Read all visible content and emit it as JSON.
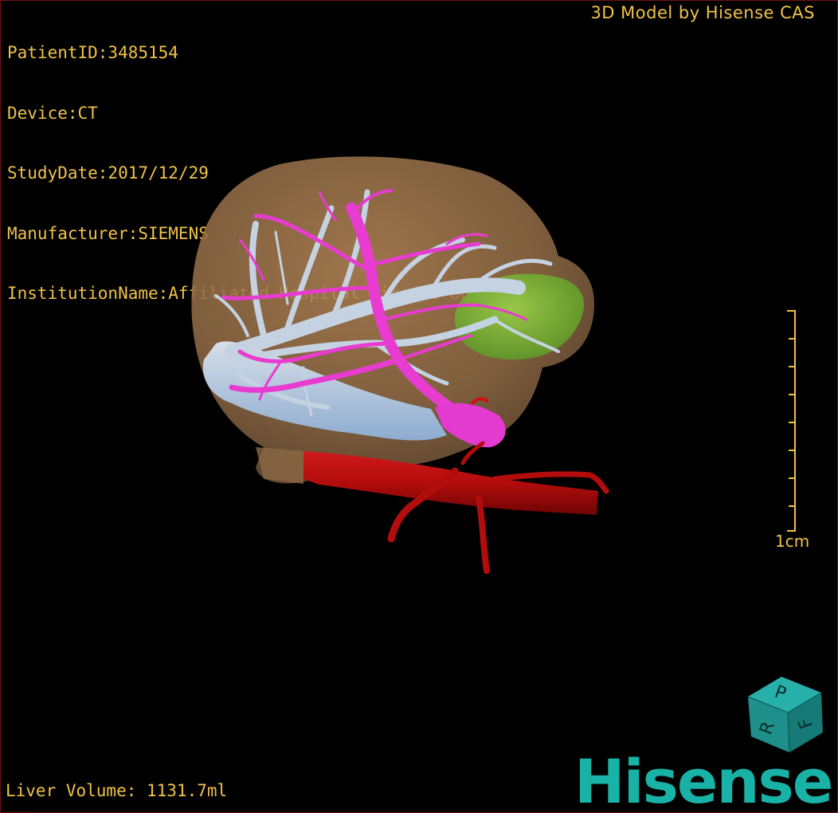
{
  "patient_info": {
    "patient_id": "PatientID:3485154",
    "device": "Device:CT",
    "study_date": "StudyDate:2017/12/29",
    "manufacturer": "Manufacturer:SIEMENS",
    "institution": "InstitutionName:Affiliated Hospital Qingdao University-C"
  },
  "brand_title": "3D Model by Hisense CAS",
  "liver_volume": "Liver Volume: 1131.7ml",
  "scale_bar": {
    "label": "1cm"
  },
  "orientation_cube": {
    "faces": [
      "P",
      "R",
      "F"
    ]
  },
  "logo_text": "Hisense",
  "colors": {
    "overlay_text": "#f0c24a",
    "liver": "#9a7148",
    "hepatic_vein": "#c9d6e6",
    "portal_vein": "#e83cd0",
    "tumor": "#7fc43a",
    "artery": "#b40b0b",
    "brand": "#18b2a6"
  },
  "icons": [
    "orientation-cube-icon",
    "hisense-logo"
  ]
}
